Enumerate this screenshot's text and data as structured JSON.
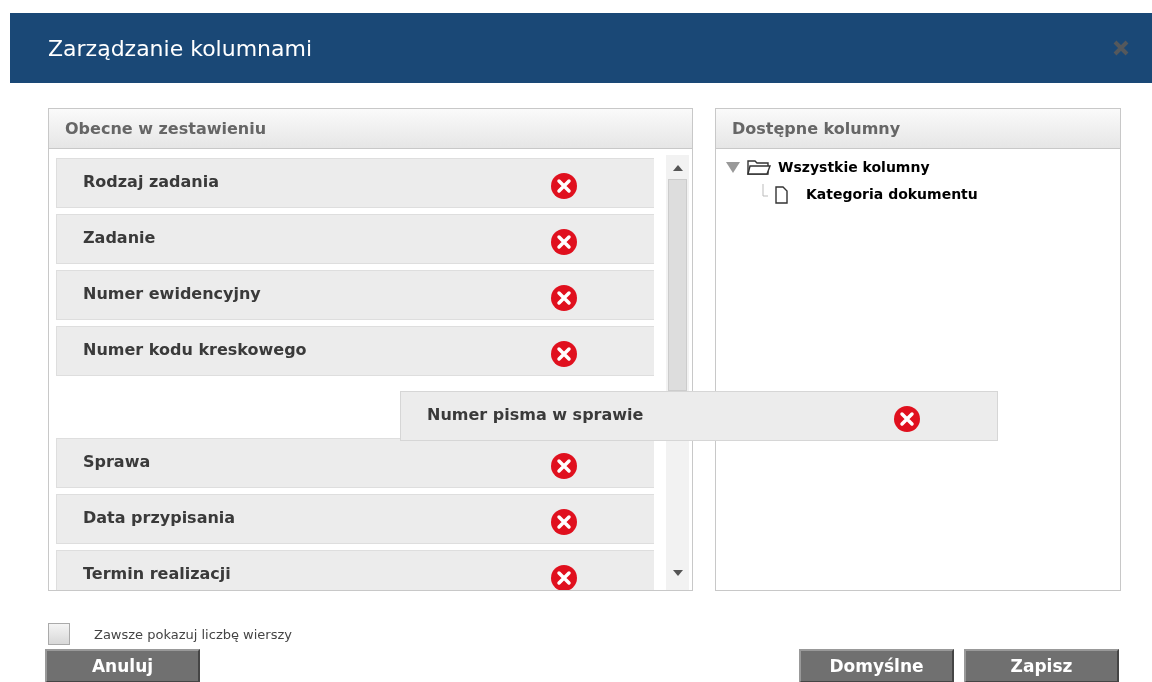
{
  "dialog": {
    "title": "Zarządzanie kolumnami"
  },
  "current_panel": {
    "title": "Obecne w zestawieniu",
    "items": [
      {
        "kind": "item",
        "label": "Rodzaj zadania"
      },
      {
        "kind": "item",
        "label": "Zadanie"
      },
      {
        "kind": "item",
        "label": "Numer ewidencyjny"
      },
      {
        "kind": "item",
        "label": "Numer kodu kreskowego"
      },
      {
        "kind": "drop-slot"
      },
      {
        "kind": "item",
        "label": "Sprawa"
      },
      {
        "kind": "item",
        "label": "Data przypisania"
      },
      {
        "kind": "item",
        "label": "Termin realizacji"
      }
    ]
  },
  "dragged_item": {
    "label": "Numer pisma w sprawie"
  },
  "available_panel": {
    "title": "Dostępne kolumny",
    "tree": [
      {
        "label": "Wszystkie kolumny",
        "expanded": true,
        "children": [
          {
            "label": "Kategoria dokumentu"
          }
        ]
      }
    ]
  },
  "show_row_count": {
    "label": "Zawsze pokazuj liczbę wierszy",
    "checked": false
  },
  "buttons": [
    {
      "label": "Anuluj"
    },
    {
      "label": "Domyślne"
    },
    {
      "label": "Zapisz"
    }
  ]
}
